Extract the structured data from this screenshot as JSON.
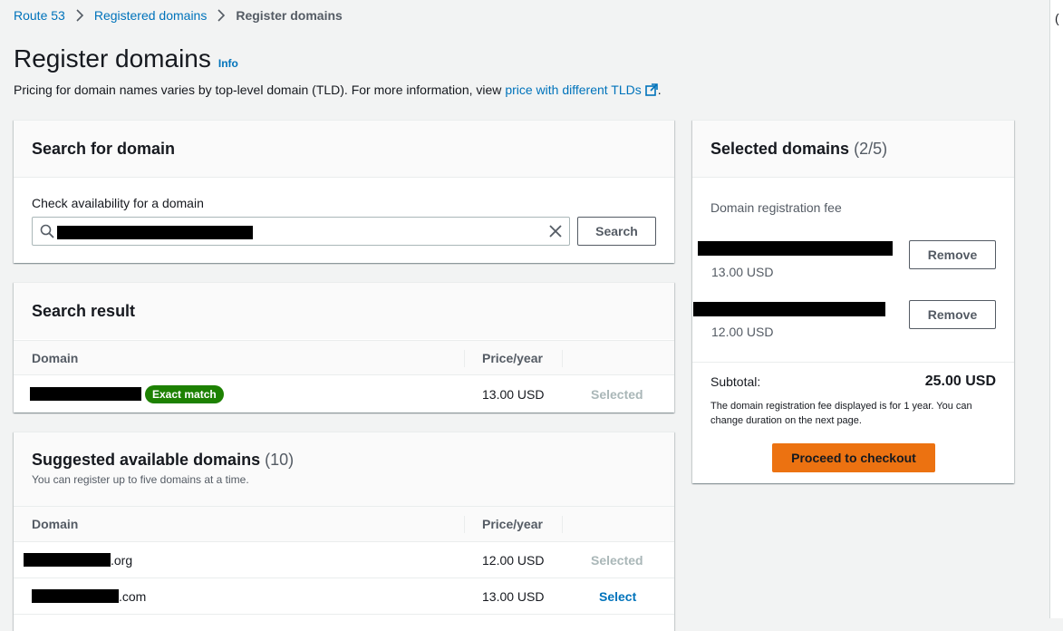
{
  "breadcrumb": {
    "items": [
      {
        "label": "Route 53"
      },
      {
        "label": "Registered domains"
      }
    ],
    "current": "Register domains"
  },
  "page": {
    "title": "Register domains",
    "info": "Info",
    "description_prefix": "Pricing for domain names varies by top-level domain (TLD). For more information, view ",
    "description_link": "price with different TLDs",
    "description_suffix": "."
  },
  "search_panel": {
    "title": "Search for domain",
    "field_label": "Check availability for a domain",
    "search_button": "Search"
  },
  "search_result": {
    "title": "Search result",
    "columns": [
      "Domain",
      "Price/year"
    ],
    "row": {
      "badge": "Exact match",
      "price": "13.00 USD",
      "status": "Selected"
    }
  },
  "suggested": {
    "title": "Suggested available domains",
    "count": "(10)",
    "subtitle": "You can register up to five domains at a time.",
    "columns": [
      "Domain",
      "Price/year"
    ],
    "rows": [
      {
        "suffix": ".org",
        "price": "12.00 USD",
        "action": "Selected"
      },
      {
        "suffix": ".com",
        "price": "13.00 USD",
        "action": "Select"
      }
    ]
  },
  "selected_panel": {
    "title": "Selected domains",
    "count": "(2/5)",
    "fee_label": "Domain registration fee",
    "items": [
      {
        "price": "13.00 USD",
        "remove": "Remove"
      },
      {
        "price": "12.00 USD",
        "remove": "Remove"
      }
    ],
    "subtotal_label": "Subtotal:",
    "subtotal_value": "25.00 USD",
    "note": "The domain registration fee displayed is for 1 year. You can change duration on the next page.",
    "checkout": "Proceed to checkout"
  },
  "colors": {
    "link": "#0073bb",
    "primary": "#ec7211",
    "success": "#1d8102",
    "background": "#f2f3f3"
  }
}
